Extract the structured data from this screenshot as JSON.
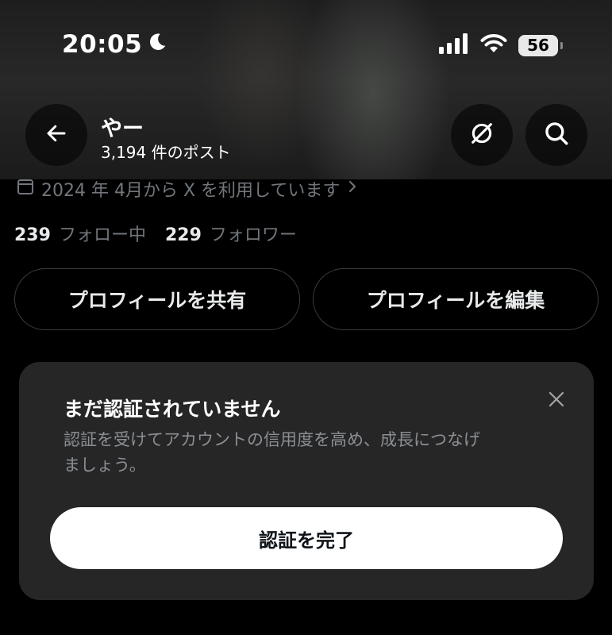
{
  "status_bar": {
    "time": "20:05",
    "battery": "56",
    "icons": [
      "moon-icon",
      "cellular-signal-icon",
      "wifi-icon",
      "battery-icon"
    ]
  },
  "header": {
    "name": "やー",
    "post_count": "3,194 件のポスト",
    "icons": [
      "back-arrow-icon",
      "grok-icon",
      "search-icon"
    ]
  },
  "profile": {
    "joined": "2024 年 4月から X を利用しています",
    "following_count": "239",
    "following_label": "フォロー中",
    "followers_count": "229",
    "followers_label": "フォロワー"
  },
  "actions": {
    "share_label": "プロフィールを共有",
    "edit_label": "プロフィールを編集"
  },
  "verify_card": {
    "title": "まだ認証されていません",
    "line1": "認証を受けてアカウントの信用度を高め、成長につなげ",
    "line2": "ましょう。",
    "cta_label": "認証を完了"
  },
  "colors": {
    "background": "#000000",
    "card": "#262626",
    "muted_text": "#71767b",
    "primary_text": "#e7e9ea"
  }
}
